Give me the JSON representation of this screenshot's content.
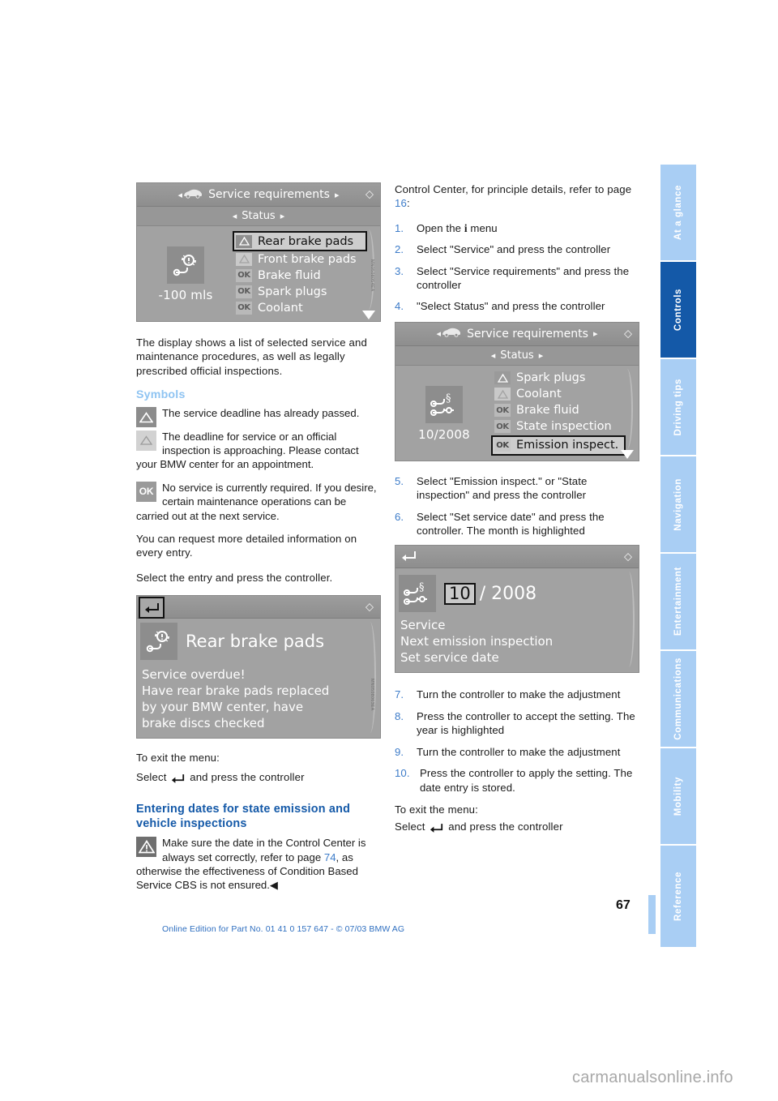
{
  "page": {
    "number": "67",
    "edition_line": "Online Edition for Part No. 01 41 0 157 647 - © 07/03 BMW AG",
    "watermark": "carmanualsonline.info"
  },
  "tabs": [
    {
      "label": "At a glance",
      "active": false
    },
    {
      "label": "Controls",
      "active": true
    },
    {
      "label": "Driving tips",
      "active": false
    },
    {
      "label": "Navigation",
      "active": false
    },
    {
      "label": "Entertainment",
      "active": false
    },
    {
      "label": "Communications",
      "active": false
    },
    {
      "label": "Mobility",
      "active": false
    },
    {
      "label": "Reference",
      "active": false
    }
  ],
  "left_column": {
    "figure1": {
      "header_title": "Service requirements",
      "subheader": "Status",
      "mileage": "-100 mls",
      "items": [
        {
          "mark": "warn",
          "label": "Rear brake pads",
          "selected": true
        },
        {
          "mark": "warn-lite",
          "label": "Front brake pads",
          "selected": false
        },
        {
          "mark": "ok",
          "label": "Brake fluid",
          "selected": false
        },
        {
          "mark": "ok",
          "label": "Spark plugs",
          "selected": false
        },
        {
          "mark": "ok",
          "label": "Coolant",
          "selected": false
        }
      ],
      "ok_text": "OK"
    },
    "intro": "The display shows a list of selected service and maintenance procedures, as well as legally prescribed official inspections.",
    "symbols_heading": "Symbols",
    "symbol_rows": [
      {
        "badge": "warn",
        "text": "The service deadline has already passed."
      },
      {
        "badge": "warn-lite",
        "text": "The deadline for service or an official inspection is approaching. Please contact your BMW center for an appointment."
      },
      {
        "badge": "ok",
        "badge_text": "OK",
        "text": "No service is currently required. If you desire, certain maintenance operations can be carried out at the next service."
      }
    ],
    "para_more_info": "You can request more detailed information on every entry.",
    "para_select_entry": "Select the entry and press the controller.",
    "figure2": {
      "title": "Rear brake pads",
      "lines": [
        "Service overdue!",
        "Have rear brake pads replaced",
        "by your BMW center, have",
        "brake discs checked"
      ]
    },
    "exit_menu_label": "To exit the menu:",
    "exit_menu_text_before": "Select",
    "exit_menu_text_after": "and press the controller",
    "section_heading": "Entering dates for state emission and vehicle inspections",
    "warning": {
      "text_part1": "Make sure the date in the Control Center is always set correctly, refer to page ",
      "page_ref": "74",
      "text_part2": ", as otherwise the effectiveness of Condition Based Service CBS is not ensured."
    }
  },
  "right_column": {
    "intro_part1": "Control Center, for principle details, refer to page ",
    "intro_ref": "16",
    "intro_part2": ":",
    "steps_a": [
      {
        "num": "1.",
        "text_before": "Open the ",
        "icon": "i-icon",
        "text_after": " menu"
      },
      {
        "num": "2.",
        "text": "Select \"Service\" and press the controller"
      },
      {
        "num": "3.",
        "text": "Select \"Service requirements\" and press the controller"
      },
      {
        "num": "4.",
        "text": "\"Select Status\" and press the controller"
      }
    ],
    "figure3": {
      "header_title": "Service requirements",
      "subheader": "Status",
      "date": "10/2008",
      "items": [
        {
          "mark": "warn",
          "label": "Spark plugs",
          "selected": false
        },
        {
          "mark": "warn-lite",
          "label": "Coolant",
          "selected": false
        },
        {
          "mark": "ok",
          "label": "Brake fluid",
          "selected": false
        },
        {
          "mark": "ok",
          "label": "State inspection",
          "selected": false
        },
        {
          "mark": "ok",
          "label": "Emission inspect.",
          "selected": true
        }
      ],
      "ok_text": "OK"
    },
    "steps_b": [
      {
        "num": "5.",
        "text": "Select \"Emission inspect.\" or \"State inspection\" and press the controller"
      },
      {
        "num": "6.",
        "text": "Select \"Set service date\" and press the controller. The month is highlighted"
      }
    ],
    "figure4": {
      "month": "10",
      "year_part": "/ 2008",
      "lines": [
        "Service",
        "Next emission inspection",
        "Set service date"
      ]
    },
    "steps_c": [
      {
        "num": "7.",
        "text": "Turn the controller to make the adjustment"
      },
      {
        "num": "8.",
        "text": "Press the controller to accept the setting. The year is highlighted"
      },
      {
        "num": "9.",
        "text": "Turn the controller to make the adjustment"
      },
      {
        "num": "10.",
        "text": "Press the controller to apply the setting. The date entry is stored."
      }
    ],
    "exit_menu_label": "To exit the menu:",
    "exit_menu_text_before": "Select",
    "exit_menu_text_after": "and press the controller"
  },
  "colors": {
    "accent_blue": "#1459a8",
    "light_blue": "#a9cef4",
    "heading_blue": "#8fc4f2",
    "link_blue": "#3d7cc9"
  }
}
